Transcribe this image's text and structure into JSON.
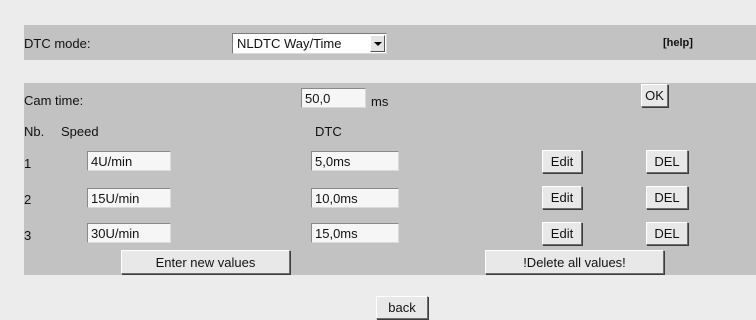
{
  "mode_bar": {
    "label": "DTC mode:",
    "selected": "NLDTC Way/Time",
    "help": "[help]"
  },
  "cam": {
    "label": "Cam time:",
    "value": "50,0",
    "unit": "ms",
    "ok": "OK"
  },
  "table": {
    "headers": {
      "nb": "Nb.",
      "speed": "Speed",
      "dtc": "DTC"
    },
    "rows": [
      {
        "nb": "1",
        "speed": "4U/min",
        "dtc": "5,0ms",
        "edit": "Edit",
        "del": "DEL"
      },
      {
        "nb": "2",
        "speed": "15U/min",
        "dtc": "10,0ms",
        "edit": "Edit",
        "del": "DEL"
      },
      {
        "nb": "3",
        "speed": "30U/min",
        "dtc": "15,0ms",
        "edit": "Edit",
        "del": "DEL"
      }
    ],
    "enter_new": "Enter new values",
    "delete_all": "!Delete all values!"
  },
  "back": "back",
  "colors": {
    "panel": "#c2c2c2",
    "page": "#ececec",
    "field": "#f6f6f6",
    "button": "#e8e8e8"
  }
}
